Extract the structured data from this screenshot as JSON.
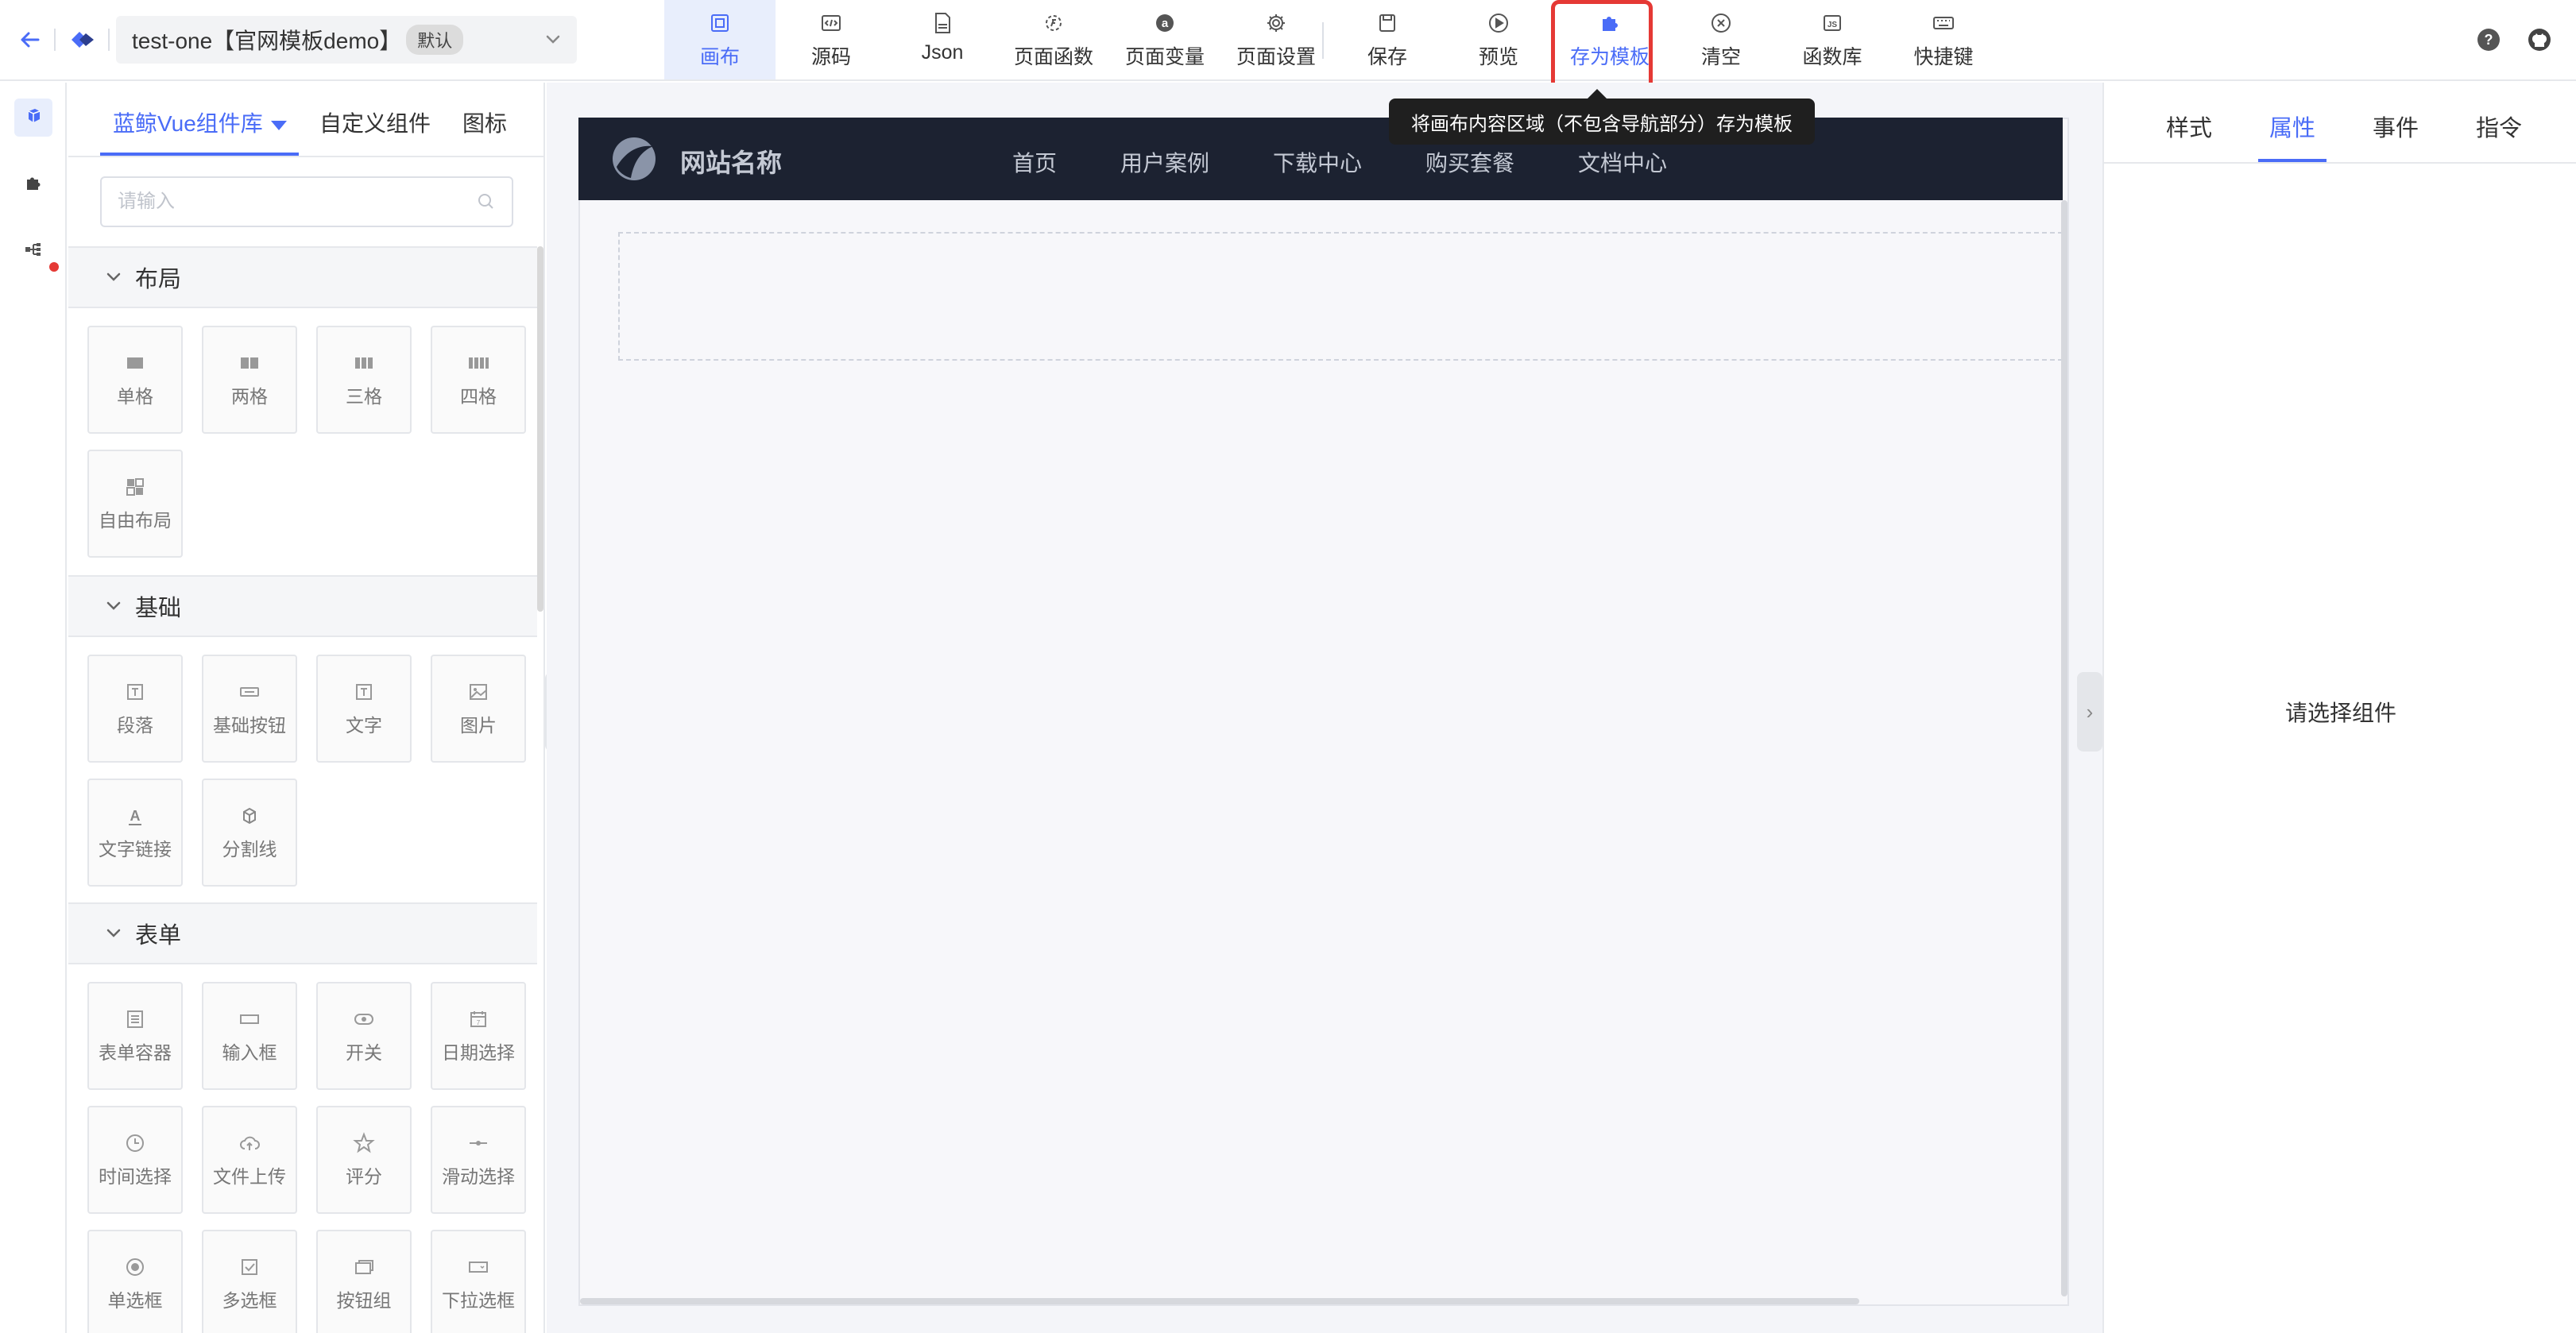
{
  "header": {
    "project_name": "test-one【官网模板demo】",
    "project_badge": "默认",
    "tools": [
      {
        "label": "画布",
        "icon": "canvas-icon"
      },
      {
        "label": "源码",
        "icon": "code-file-icon"
      },
      {
        "label": "Json",
        "icon": "json-file-icon"
      },
      {
        "label": "页面函数",
        "icon": "function-gear-icon"
      },
      {
        "label": "页面变量",
        "icon": "variable-icon"
      },
      {
        "label": "页面设置",
        "icon": "gear-icon"
      },
      {
        "label": "保存",
        "icon": "save-icon"
      },
      {
        "label": "预览",
        "icon": "play-circle-icon"
      },
      {
        "label": "存为模板",
        "icon": "puzzle-icon"
      },
      {
        "label": "清空",
        "icon": "clear-circle-icon"
      },
      {
        "label": "函数库",
        "icon": "js-icon"
      },
      {
        "label": "快捷键",
        "icon": "keyboard-icon"
      }
    ],
    "active_tool": "画布",
    "highlighted_tool": "存为模板"
  },
  "tooltip": {
    "text": "将画布内容区域（不包含导航部分）存为模板"
  },
  "component_panel": {
    "tabs": [
      "蓝鲸Vue组件库",
      "自定义组件",
      "图标"
    ],
    "search_placeholder": "请输入",
    "sections": [
      {
        "title": "布局",
        "items": [
          "单格",
          "两格",
          "三格",
          "四格",
          "自由布局"
        ]
      },
      {
        "title": "基础",
        "items": [
          "段落",
          "基础按钮",
          "文字",
          "图片",
          "文字链接",
          "分割线"
        ]
      },
      {
        "title": "表单",
        "items": [
          "表单容器",
          "输入框",
          "开关",
          "日期选择",
          "时间选择",
          "文件上传",
          "评分",
          "滑动选择",
          "单选框",
          "多选框",
          "按钮组",
          "下拉选框"
        ]
      }
    ]
  },
  "canvas": {
    "site_title": "网站名称",
    "menu": [
      "首页",
      "用户案例",
      "下载中心",
      "购买套餐",
      "文档中心"
    ]
  },
  "right_panel": {
    "tabs": [
      "样式",
      "属性",
      "事件",
      "指令"
    ],
    "active_tab": "属性",
    "empty_hint": "请选择组件"
  },
  "colors": {
    "accent": "#4a6cf7",
    "highlight_border": "#e53935",
    "site_nav_bg": "#1c2231",
    "tooltip_bg": "#1f1f1f"
  }
}
